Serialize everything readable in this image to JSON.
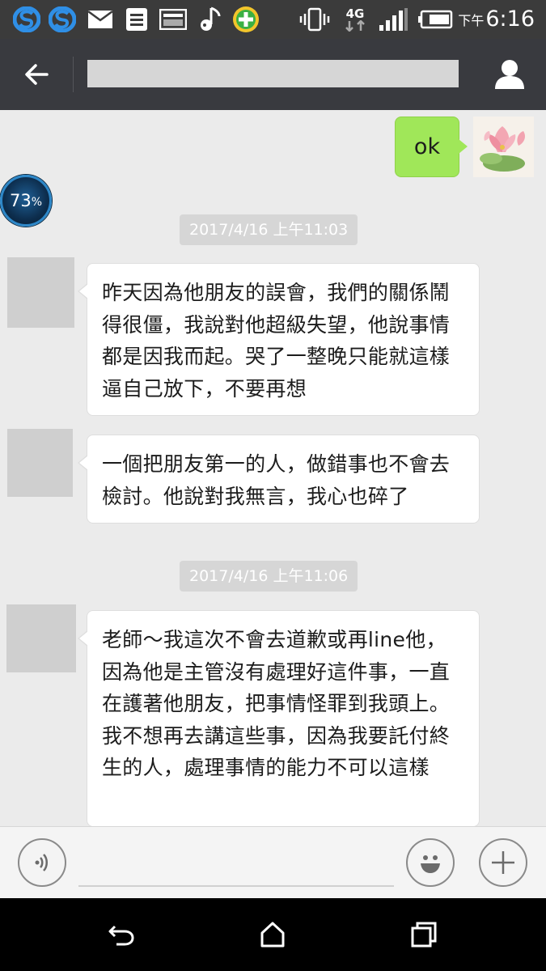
{
  "status_bar": {
    "time_ampm": "下午",
    "time": "6:16",
    "network": "4G",
    "icons": [
      "sync-s-icon",
      "sync-s-icon",
      "mail-icon",
      "notes-icon",
      "gallery-icon",
      "music-icon",
      "security-plus-icon",
      "vibrate-icon",
      "network-4g-icon",
      "signal-icon",
      "battery-icon"
    ]
  },
  "header": {
    "back_icon": "arrow-left-icon",
    "profile_icon": "person-icon"
  },
  "battery_badge": {
    "value": "73",
    "unit": "%"
  },
  "messages": {
    "outgoing_1": "ok",
    "timestamp_1": "2017/4/16 上午11:03",
    "incoming_1": "昨天因為他朋友的誤會，我們的關係鬧得很僵，我說對他超級失望，他說事情都是因我而起。哭了一整晚只能就這樣逼自己放下，不要再想",
    "incoming_2": "一個把朋友第一的人，做錯事也不會去檢討。他說對我無言，我心也碎了",
    "timestamp_2": "2017/4/16 上午11:06",
    "incoming_3": "老師～我這次不會去道歉或再line他，因為他是主管沒有處理好這件事，一直在護著他朋友，把事情怪罪到我頭上。我不想再去講這些事，因為我要託付終生的人，處理事情的能力不可以這樣"
  },
  "input_bar": {
    "voice_icon": "voice-icon",
    "input_value": "",
    "emoji_icon": "emoji-smile-icon",
    "plus_icon": "plus-icon"
  },
  "nav_bar": {
    "icons": [
      "back-icon",
      "home-icon",
      "recents-icon"
    ]
  }
}
